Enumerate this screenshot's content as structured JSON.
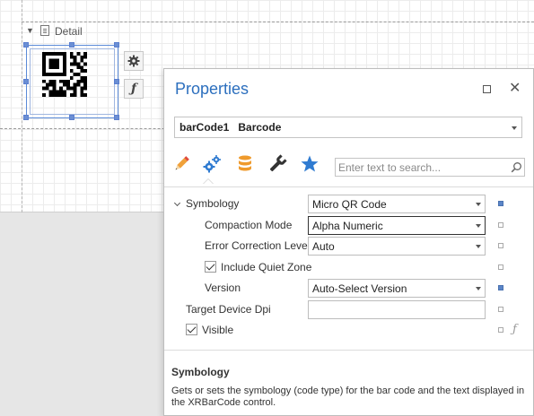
{
  "designer": {
    "band": {
      "label": "Detail"
    }
  },
  "properties": {
    "title": "Properties",
    "object": {
      "name": "barCode1",
      "type": "Barcode"
    },
    "tabs": [
      {
        "icon": "pencil-icon"
      },
      {
        "icon": "gears-icon"
      },
      {
        "icon": "database-icon"
      },
      {
        "icon": "wrench-icon"
      },
      {
        "icon": "star-icon"
      }
    ],
    "search": {
      "placeholder": "Enter text to search..."
    },
    "rows": {
      "symbology": {
        "name": "Symbology",
        "value": "Micro QR Code"
      },
      "compaction_mode": {
        "name": "Compaction Mode",
        "value": "Alpha Numeric"
      },
      "error_correction": {
        "name": "Error Correction Level",
        "value": "Auto"
      },
      "quiet_zone": {
        "name": "Include Quiet Zone",
        "checked": true
      },
      "version": {
        "name": "Version",
        "value": "Auto-Select Version"
      },
      "target_dpi": {
        "name": "Target Device Dpi",
        "value": ""
      },
      "visible": {
        "name": "Visible",
        "checked": true
      }
    },
    "description": {
      "title": "Symbology",
      "text": "Gets or sets the symbology (code type) for the bar code and the text displayed in the XRBarCode control."
    },
    "colors": {
      "accent": "#2c6fbe",
      "marker": "#5b86c8"
    }
  }
}
